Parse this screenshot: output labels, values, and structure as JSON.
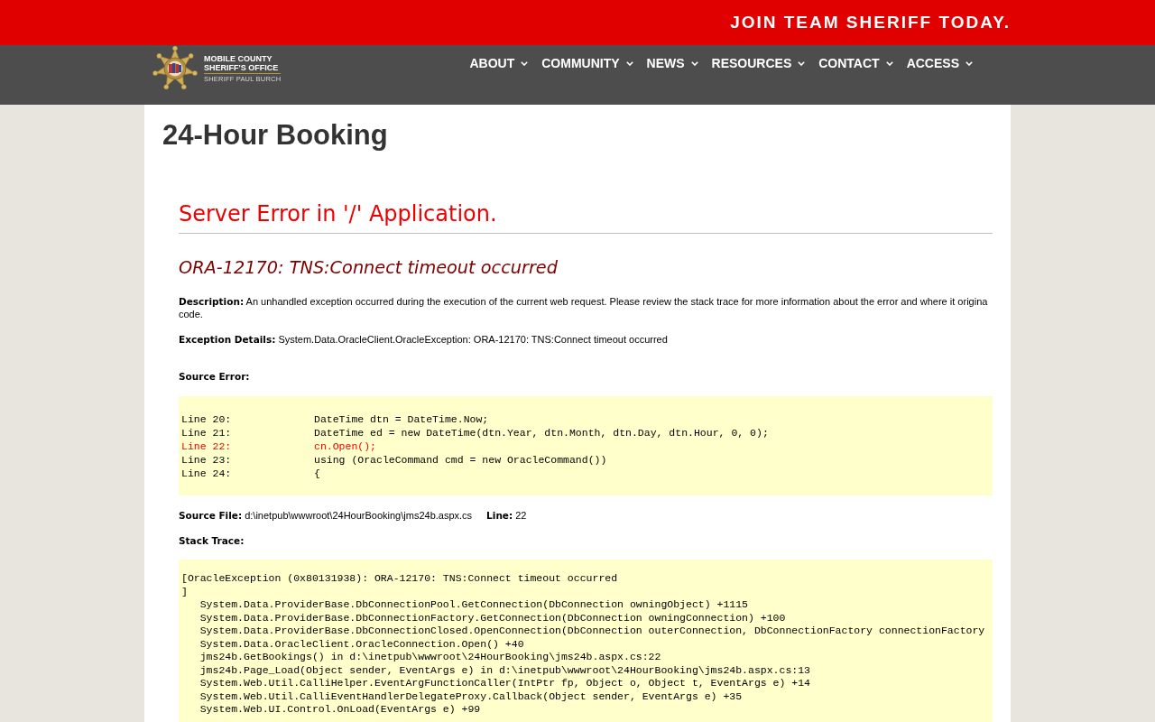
{
  "top_bar": {
    "cta": "JOIN TEAM SHERIFF TODAY."
  },
  "header": {
    "logo": {
      "lines": [
        "MOBILE COUNTY",
        "SHERIFF'S OFFICE"
      ],
      "subtitle": "SHERIFF PAUL BURCH"
    },
    "nav": [
      {
        "label": "ABOUT"
      },
      {
        "label": "COMMUNITY"
      },
      {
        "label": "NEWS"
      },
      {
        "label": "RESOURCES"
      },
      {
        "label": "CONTACT"
      },
      {
        "label": "ACCESS"
      }
    ]
  },
  "page": {
    "title": "24-Hour Booking"
  },
  "error_page": {
    "heading": "Server Error in '/' Application.",
    "error_title": "ORA-12170: TNS:Connect timeout occurred",
    "description": [
      "**Description:** An unhandled exception occurred during the execution of the current web request. Please review the stack trace for more information about the error and where it origina",
      "code."
    ],
    "exception_details": "**Exception Details:** System.Data.OracleClient.OracleException: ORA-12170: TNS:Connect timeout occurred",
    "source_error": {
      "label": "Source Error:",
      "lines": [
        {
          "number": "Line 20:",
          "code": "DateTime dtn = DateTime.Now;",
          "highlighted": false
        },
        {
          "number": "Line 21:",
          "code": "DateTime ed = new DateTime(dtn.Year, dtn.Month, dtn.Day, dtn.Hour, 0, 0);",
          "highlighted": false
        },
        {
          "number": "Line 22:",
          "code": "cn.Open();",
          "highlighted": true
        },
        {
          "number": "Line 23:",
          "code": "using (OracleCommand cmd = new OracleCommand())",
          "highlighted": false
        },
        {
          "number": "Line 24:",
          "code": "{",
          "highlighted": false
        }
      ]
    },
    "source_file": {
      "path": "**Source File:** d:\\inetpub\\wwwroot\\24HourBooking\\jms24b.aspx.cs",
      "line": "**Line:** 22"
    },
    "stack_trace": {
      "label": "Stack Trace:",
      "exception": "[OracleException (0x80131938): ORA-12170: TNS:Connect timeout occurred",
      "closing": "]",
      "frames": [
        "System.Data.ProviderBase.DbConnectionPool.GetConnection(DbConnection owningObject) +1115",
        "System.Data.ProviderBase.DbConnectionFactory.GetConnection(DbConnection owningConnection) +100",
        "System.Data.ProviderBase.DbConnectionClosed.OpenConnection(DbConnection outerConnection, DbConnectionFactory connectionFactory",
        "System.Data.OracleClient.OracleConnection.Open() +40",
        "jms24b.GetBookings() in d:\\inetpub\\wwwroot\\24HourBooking\\jms24b.aspx.cs:22",
        "jms24b.Page_Load(Object sender, EventArgs e) in d:\\inetpub\\wwwroot\\24HourBooking\\jms24b.aspx.cs:13",
        "System.Web.Util.CalliHelper.EventArgFunctionCaller(IntPtr fp, Object o, Object t, EventArgs e) +14",
        "System.Web.Util.CalliEventHandlerDelegateProxy.Callback(Object sender, EventArgs e) +35",
        "System.Web.UI.Control.OnLoad(EventArgs e) +99"
      ]
    }
  }
}
